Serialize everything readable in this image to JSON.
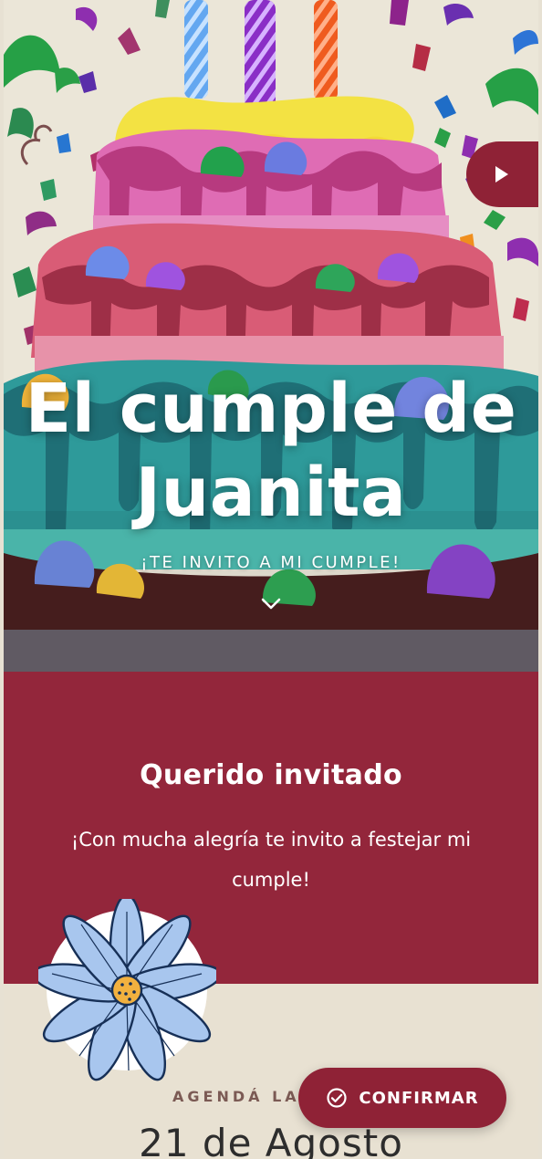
{
  "hero": {
    "title_line_1": "El cumple de",
    "title_line_2": "Juanita",
    "subtitle": "¡TE INVITO A MI CUMPLE!"
  },
  "icons": {
    "play": "play-icon",
    "scroll": "chevron-down-icon",
    "confirm": "check-circle-icon",
    "flower": "flower-icon",
    "cake": "birthday-cake-illustration"
  },
  "greeting": {
    "heading": "Querido invitado",
    "message": "¡Con mucha alegría te invito a festejar mi cumple!"
  },
  "date": {
    "kicker": "AGENDÁ LA",
    "value": "21 de Agosto"
  },
  "actions": {
    "confirm_label": "CONFIRMAR"
  },
  "colors": {
    "accent": "#93263b",
    "cream": "#e8e1d2",
    "button": "#8f2236"
  }
}
